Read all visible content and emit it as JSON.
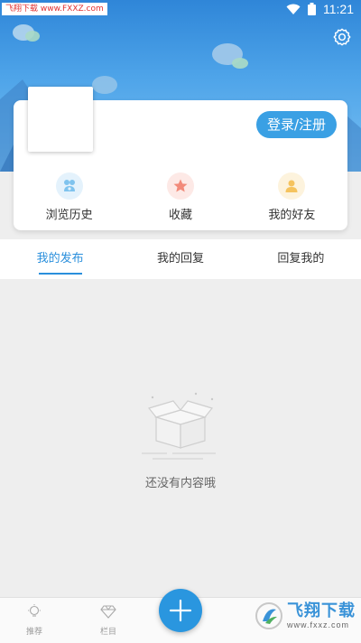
{
  "status_bar": {
    "time": "11:21",
    "watermark": "飞翔下载 www.FXXZ.com",
    "wifi_icon": "wifi-icon",
    "battery_icon": "battery-icon"
  },
  "header": {
    "settings_icon": "gear-icon"
  },
  "profile": {
    "login_label": "登录/注册",
    "quick_items": [
      {
        "label": "浏览历史",
        "icon": "history-icon",
        "color": "#7fc3ee",
        "bg": "#e4f2fc"
      },
      {
        "label": "收藏",
        "icon": "star-icon",
        "color": "#f28a7a",
        "bg": "#fde9e6"
      },
      {
        "label": "我的好友",
        "icon": "friends-icon",
        "color": "#f5c35e",
        "bg": "#fdf3dd"
      }
    ]
  },
  "tabs": [
    {
      "label": "我的发布",
      "active": true
    },
    {
      "label": "我的回复",
      "active": false
    },
    {
      "label": "回复我的",
      "active": false
    }
  ],
  "empty_state": {
    "text": "还没有内容哦",
    "icon": "empty-box-icon"
  },
  "bottom_nav": {
    "items": [
      {
        "label": "推荐",
        "icon": "lightbulb-icon"
      },
      {
        "label": "栏目",
        "icon": "diamond-icon"
      }
    ],
    "fab_icon": "plus-icon"
  },
  "watermark_br": {
    "main": "飞翔下载",
    "sub": "www.fxxz.com"
  },
  "colors": {
    "accent": "#2a8fdc",
    "button": "#3aa0e4",
    "header_top": "#2f86d8",
    "header_bottom": "#79c0f2"
  }
}
